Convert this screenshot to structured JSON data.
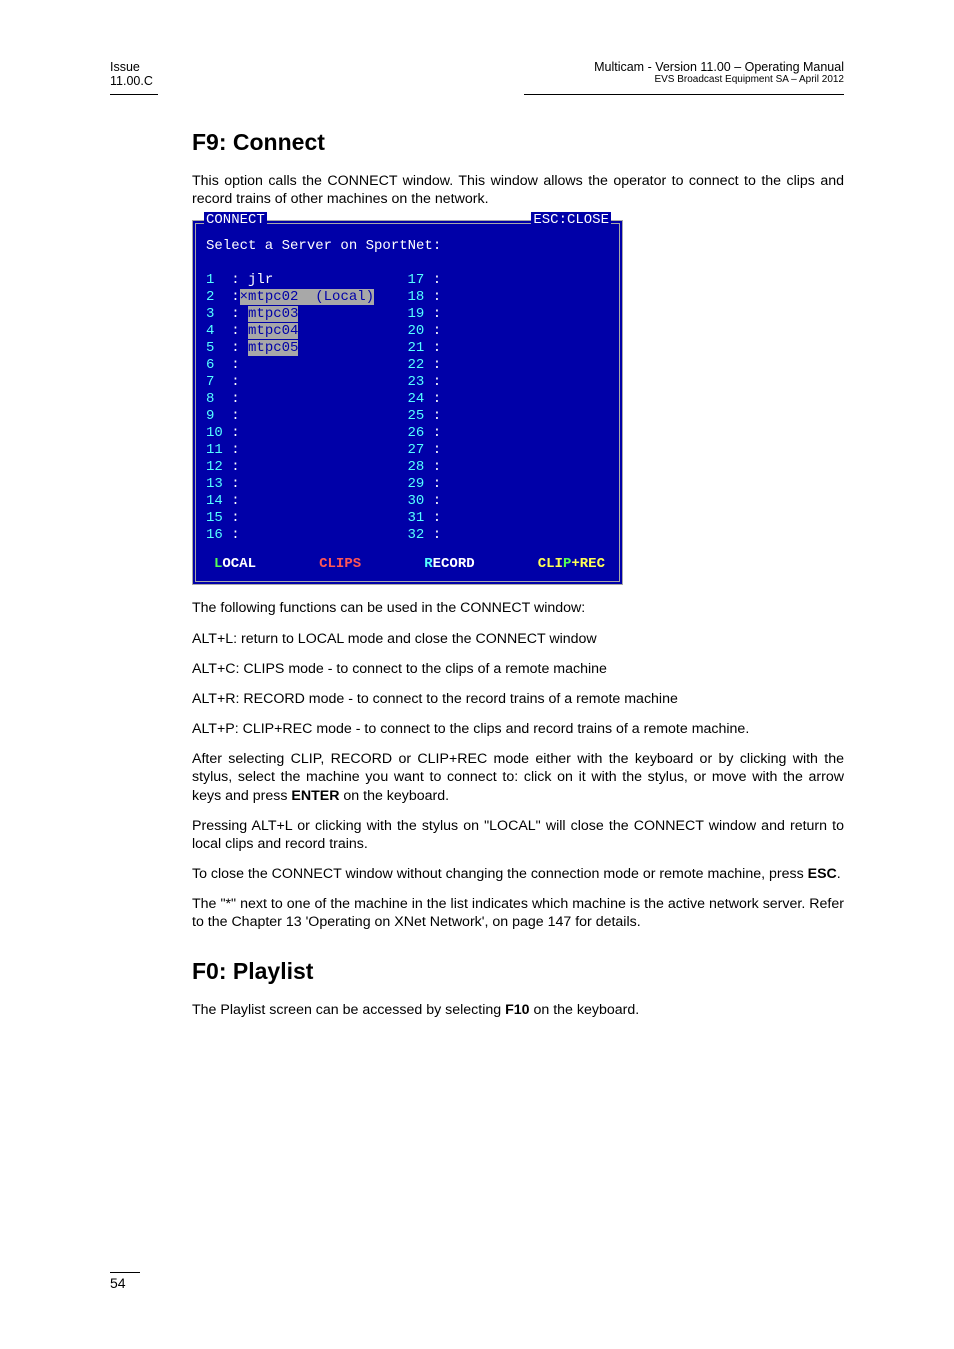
{
  "header": {
    "issue_label": "Issue",
    "issue_value": "11.00.C",
    "product": "Multicam - Version 11.00 – Operating Manual",
    "company": "EVS Broadcast Equipment SA – April 2012"
  },
  "sections": {
    "f9_title": "F9: Connect",
    "f9_intro": "This option calls the CONNECT window. This window allows the operator to connect to the clips and record trains of other machines on the network.",
    "after_terminal_intro": "The following functions can be used in the CONNECT window:",
    "alt_l": "ALT+L: return to LOCAL mode and close the CONNECT window",
    "alt_c": "ALT+C: CLIPS mode - to connect to the clips of a remote machine",
    "alt_r": "ALT+R: RECORD mode - to connect to the record trains of a remote machine",
    "alt_p": "ALT+P: CLIP+REC mode - to connect to the clips and record trains of a remote machine.",
    "after_select_1": "After selecting CLIP, RECORD or CLIP+REC mode either with the keyboard or by clicking with the stylus, select the machine you want to connect to: click on it with the stylus, or move with the arrow keys and press ",
    "after_select_enter": "ENTER",
    "after_select_2": " on the keyboard.",
    "pressing_altl": "Pressing ALT+L or clicking with the stylus on \"LOCAL\" will close the CONNECT window and return to local clips and record trains.",
    "close_window_1": "To close the CONNECT window without changing the connection mode or remote machine, press ",
    "close_window_esc": "ESC",
    "close_window_2": ".",
    "asterisk_note": "The \"*\" next to one of the machine in the list indicates which machine is the active network server. Refer to the Chapter 13 'Operating on XNet Network', on page 147 for details.",
    "f0_title": "F0: Playlist",
    "f0_body_1": "The Playlist screen can be accessed by selecting ",
    "f0_body_f10": "F10",
    "f0_body_2": " on the keyboard."
  },
  "terminal": {
    "title_left": "CONNECT",
    "title_right": "ESC:CLOSE",
    "prompt": "Select a Server on SportNet:",
    "left_rows": [
      {
        "n": "1 ",
        "sep": " : ",
        "name": "jlr",
        "extra": ""
      },
      {
        "n": "2 ",
        "sep": " :",
        "name": "×mtpc02",
        "extra": "  (Local)",
        "highlight": true
      },
      {
        "n": "3 ",
        "sep": " : ",
        "name": "mtpc03",
        "extra": "",
        "highlight_name": true
      },
      {
        "n": "4 ",
        "sep": " : ",
        "name": "mtpc04",
        "extra": "",
        "highlight_name": true
      },
      {
        "n": "5 ",
        "sep": " : ",
        "name": "mtpc05",
        "extra": "",
        "highlight_name": true
      },
      {
        "n": "6 ",
        "sep": " :",
        "name": "",
        "extra": ""
      },
      {
        "n": "7 ",
        "sep": " :",
        "name": "",
        "extra": ""
      },
      {
        "n": "8 ",
        "sep": " :",
        "name": "",
        "extra": ""
      },
      {
        "n": "9 ",
        "sep": " :",
        "name": "",
        "extra": ""
      },
      {
        "n": "10",
        "sep": " :",
        "name": "",
        "extra": ""
      },
      {
        "n": "11",
        "sep": " :",
        "name": "",
        "extra": ""
      },
      {
        "n": "12",
        "sep": " :",
        "name": "",
        "extra": ""
      },
      {
        "n": "13",
        "sep": " :",
        "name": "",
        "extra": ""
      },
      {
        "n": "14",
        "sep": " :",
        "name": "",
        "extra": ""
      },
      {
        "n": "15",
        "sep": " :",
        "name": "",
        "extra": ""
      },
      {
        "n": "16",
        "sep": " :",
        "name": "",
        "extra": ""
      }
    ],
    "right_rows": [
      "17 :",
      "18 :",
      "19 :",
      "20 :",
      "21 :",
      "22 :",
      "23 :",
      "24 :",
      "25 :",
      "26 :",
      "27 :",
      "28 :",
      "29 :",
      "30 :",
      "31 :",
      "32 :"
    ],
    "footer": {
      "local": {
        "hotkey": "L",
        "rest": "OCAL"
      },
      "clips": "CLIPS",
      "record": {
        "hotkey": "R",
        "rest": "ECORD"
      },
      "cliprec": {
        "pre": "CLI",
        "hotkey": "P",
        "rest": "+REC"
      }
    }
  },
  "page_number": "54"
}
